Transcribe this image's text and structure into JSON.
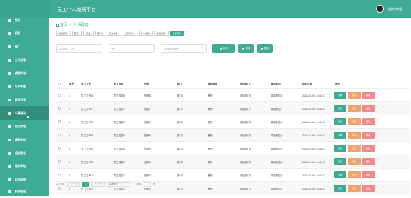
{
  "header": {
    "title": "员工个人发展平台",
    "user": "超级管理"
  },
  "sidebar": {
    "items": [
      {
        "label": "系统首页"
      },
      {
        "label": "员工"
      },
      {
        "label": "职位"
      },
      {
        "label": "部门"
      },
      {
        "label": "工作记录"
      },
      {
        "label": "请假申请"
      },
      {
        "label": "打卡考勤"
      },
      {
        "label": "奖惩记录"
      },
      {
        "label": "人事调动",
        "active": true
      },
      {
        "label": "员工离职"
      },
      {
        "label": "绩效考核"
      },
      {
        "label": "培训报名"
      },
      {
        "label": "培训考核"
      },
      {
        "label": "公司通知"
      },
      {
        "label": "系统管理"
      }
    ]
  },
  "breadcrumb": {
    "home": "首页",
    "current": "人事调动"
  },
  "tabs": [
    {
      "label": "系统首页 ×"
    },
    {
      "label": "员工 ×"
    },
    {
      "label": "职位 ×"
    },
    {
      "label": "部门 ×"
    },
    {
      "label": "工作记录 ×"
    },
    {
      "label": "请假申请 ×"
    },
    {
      "label": "打卡考勤 ×"
    },
    {
      "label": "奖惩记录 ×"
    },
    {
      "label": "人事调动 ×",
      "active": true
    }
  ],
  "filters": {
    "employee_placeholder": "请选择员工工号",
    "dept_placeholder": "部门",
    "type_placeholder": "请选择调动类型",
    "search_label": "查询",
    "add_label": "添加",
    "delete_label": "删除"
  },
  "table": {
    "headers": [
      "序号",
      "员工工号",
      "员工姓名",
      "性别",
      "部门",
      "调动类型",
      "调动部门",
      "调动职位",
      "调动日期",
      "操作"
    ],
    "rows": [
      [
        "1",
        "员工工号8",
        "员工姓名8",
        "性别8",
        "部门8",
        "晋升",
        "调动部门8",
        "调动职位8",
        "2024-04-09 14:44:10"
      ],
      [
        "2",
        "员工工号7",
        "员工姓名7",
        "性别7",
        "部门7",
        "晋升",
        "调动部门7",
        "调动职位7",
        "2024-04-09 14:44:10"
      ],
      [
        "3",
        "员工工号6",
        "员工姓名6",
        "性别6",
        "部门6",
        "晋升",
        "调动部门6",
        "调动职位6",
        "2024-04-09 14:44:10"
      ],
      [
        "4",
        "员工工号5",
        "员工姓名5",
        "性别5",
        "部门5",
        "晋升",
        "调动部门5",
        "调动职位5",
        "2024-04-09 14:44:10"
      ],
      [
        "5",
        "员工工号4",
        "员工姓名4",
        "性别4",
        "部门4",
        "晋升",
        "调动部门4",
        "调动职位4",
        "2024-04-09 14:44:10"
      ],
      [
        "6",
        "员工工号3",
        "员工姓名3",
        "性别3",
        "部门3",
        "晋升",
        "调动部门3",
        "调动职位3",
        "2024-04-09 14:44:10"
      ],
      [
        "7",
        "员工工号2",
        "员工姓名2",
        "性别2",
        "部门2",
        "晋升",
        "调动部门2",
        "调动职位2",
        "2024-04-09 14:44:10"
      ],
      [
        "8",
        "员工工号1",
        "员工姓名1",
        "性别1",
        "部门1",
        "晋升",
        "调动部门1",
        "调动职位1",
        "2024-04-09 14:44:10"
      ]
    ],
    "ops": {
      "view": "查看",
      "edit": "修改",
      "del": "删除"
    }
  },
  "pager": {
    "total": "共 8 条",
    "prev": "上一页",
    "page": "1",
    "next": "下一页",
    "page_size": "10条/页",
    "goto_label": "前往",
    "goto_value": "1",
    "goto_suffix": "页"
  },
  "colors": {
    "accent": "#3eac94",
    "edit": "#f0a36a",
    "delete": "#f08a8a"
  }
}
